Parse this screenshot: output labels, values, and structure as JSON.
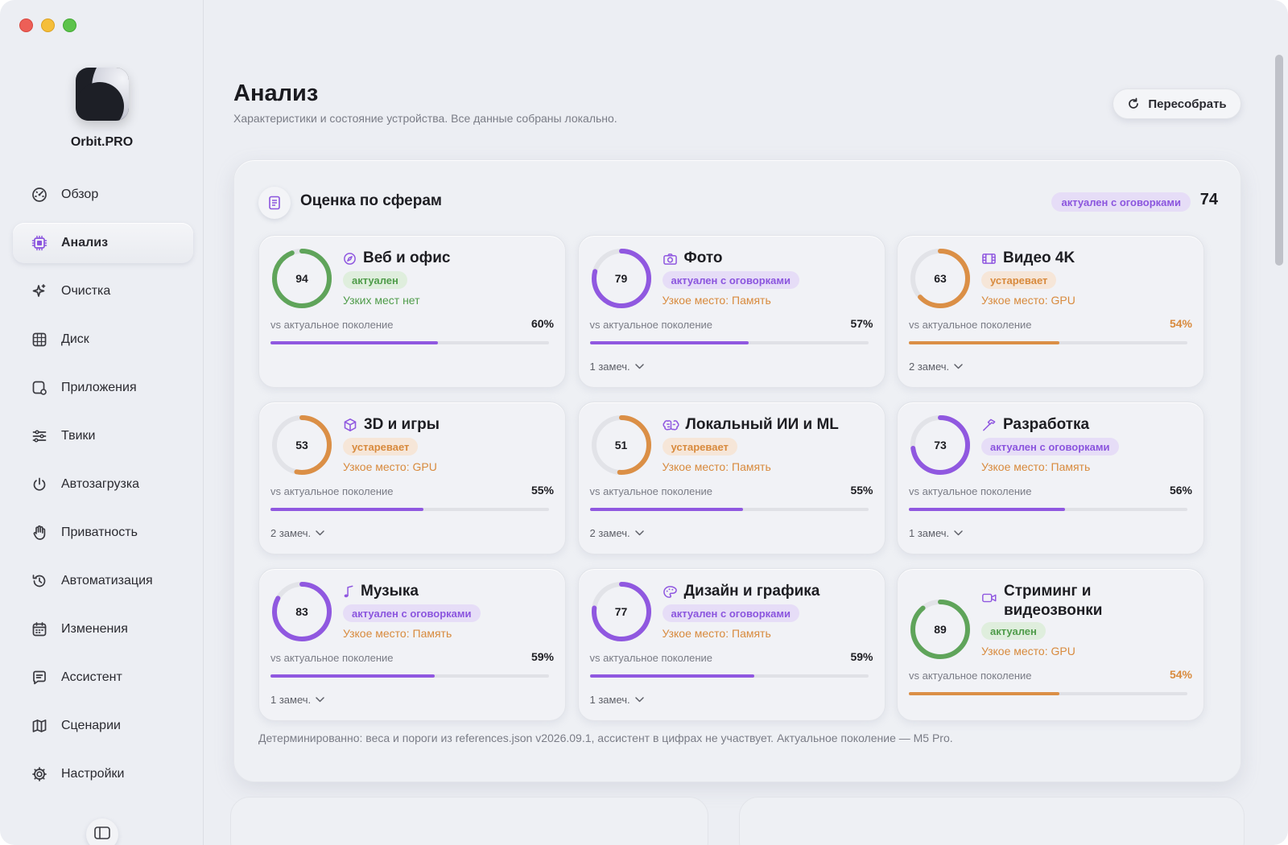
{
  "app": {
    "name": "Orbit.PRO"
  },
  "sidebar": {
    "items": [
      {
        "label": "Обзор",
        "icon": "gauge-icon"
      },
      {
        "label": "Анализ",
        "icon": "chip-icon",
        "active": true
      },
      {
        "label": "Очистка",
        "icon": "sparkles-icon"
      },
      {
        "label": "Диск",
        "icon": "grid-icon"
      },
      {
        "label": "Приложения",
        "icon": "app-gear-icon"
      },
      {
        "label": "Твики",
        "icon": "sliders-icon"
      },
      {
        "label": "Автозагрузка",
        "icon": "power-icon"
      },
      {
        "label": "Приватность",
        "icon": "hand-icon"
      },
      {
        "label": "Автоматизация",
        "icon": "clock-arrow-icon"
      },
      {
        "label": "Изменения",
        "icon": "calendar-icon"
      },
      {
        "label": "Ассистент",
        "icon": "chat-icon"
      },
      {
        "label": "Сценарии",
        "icon": "map-icon"
      },
      {
        "label": "Настройки",
        "icon": "gear-icon"
      }
    ]
  },
  "header": {
    "title": "Анализ",
    "subtitle": "Характеристики и состояние устройства. Все данные собраны локально.",
    "rebuild_label": "Пересобрать"
  },
  "panel": {
    "title": "Оценка по сферам",
    "overall_badge": "актуален с оговорками",
    "overall_score": "74",
    "vs_label": "vs актуальное поколение",
    "footnote": "Детерминированно: веса и пороги из references.json v2026.09.1, ассистент в цифрах не участвует. Актуальное поколение — M5 Pro."
  },
  "cards": [
    {
      "title": "Веб и офис",
      "icon": "compass-icon",
      "score": "94",
      "status": "актуален",
      "status_tone": "green",
      "bottleneck": "Узких мест нет",
      "bottleneck_tone": "green",
      "pct": "60%",
      "pct_value": 0.6,
      "pct_tone": "dark",
      "notes": ""
    },
    {
      "title": "Фото",
      "icon": "camera-icon",
      "score": "79",
      "status": "актуален с оговорками",
      "status_tone": "purple",
      "bottleneck": "Узкое место: Память",
      "bottleneck_tone": "orange",
      "pct": "57%",
      "pct_value": 0.57,
      "pct_tone": "dark",
      "notes": "1 замеч."
    },
    {
      "title": "Видео 4K",
      "icon": "film-icon",
      "score": "63",
      "status": "устаревает",
      "status_tone": "orange",
      "bottleneck": "Узкое место: GPU",
      "bottleneck_tone": "orange",
      "pct": "54%",
      "pct_value": 0.54,
      "pct_tone": "orange",
      "notes": "2 замеч."
    },
    {
      "title": "3D и игры",
      "icon": "cube-icon",
      "score": "53",
      "status": "устаревает",
      "status_tone": "orange",
      "bottleneck": "Узкое место: GPU",
      "bottleneck_tone": "orange",
      "pct": "55%",
      "pct_value": 0.55,
      "pct_tone": "dark",
      "notes": "2 замеч."
    },
    {
      "title": "Локальный ИИ и ML",
      "icon": "brain-icon",
      "score": "51",
      "status": "устаревает",
      "status_tone": "orange",
      "bottleneck": "Узкое место: Память",
      "bottleneck_tone": "orange",
      "pct": "55%",
      "pct_value": 0.55,
      "pct_tone": "dark",
      "notes": "2 замеч."
    },
    {
      "title": "Разработка",
      "icon": "hammer-icon",
      "score": "73",
      "status": "актуален с оговорками",
      "status_tone": "purple",
      "bottleneck": "Узкое место: Память",
      "bottleneck_tone": "orange",
      "pct": "56%",
      "pct_value": 0.56,
      "pct_tone": "dark",
      "notes": "1 замеч."
    },
    {
      "title": "Музыка",
      "icon": "music-note-icon",
      "score": "83",
      "status": "актуален с оговорками",
      "status_tone": "purple",
      "bottleneck": "Узкое место: Память",
      "bottleneck_tone": "orange",
      "pct": "59%",
      "pct_value": 0.59,
      "pct_tone": "dark",
      "notes": "1 замеч."
    },
    {
      "title": "Дизайн и графика",
      "icon": "palette-icon",
      "score": "77",
      "status": "актуален с оговорками",
      "status_tone": "purple",
      "bottleneck": "Узкое место: Память",
      "bottleneck_tone": "orange",
      "pct": "59%",
      "pct_value": 0.59,
      "pct_tone": "dark",
      "notes": "1 замеч."
    },
    {
      "title": "Стриминг и видеозвонки",
      "title_lines": [
        "Стриминг и",
        "видеозвонки"
      ],
      "icon": "video-camera-icon",
      "score": "89",
      "status": "актуален",
      "status_tone": "green",
      "bottleneck": "Узкое место: GPU",
      "bottleneck_tone": "orange",
      "pct": "54%",
      "pct_value": 0.54,
      "pct_tone": "orange",
      "notes": ""
    }
  ],
  "colors": {
    "purple": "#9058e0",
    "green": "#5fa45a",
    "orange": "#db8f46",
    "ring_track": "#e2e3e8"
  }
}
